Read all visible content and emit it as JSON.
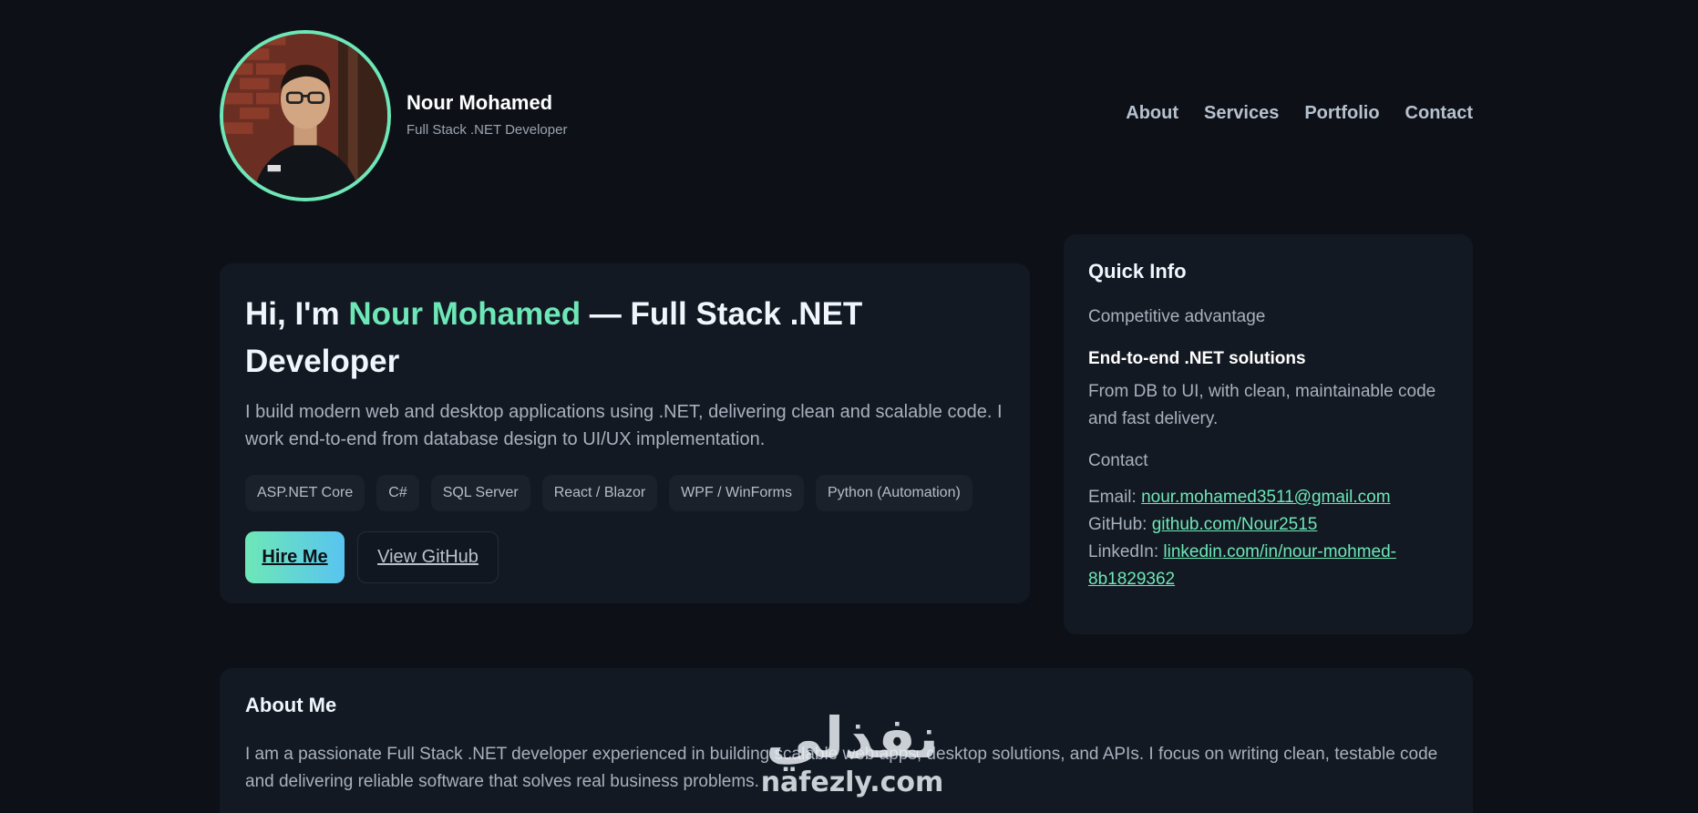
{
  "header": {
    "name": "Nour Mohamed",
    "role": "Full Stack .NET Developer",
    "nav": [
      "About",
      "Services",
      "Portfolio",
      "Contact"
    ]
  },
  "hero": {
    "title_prefix": "Hi, I'm ",
    "title_accent": "Nour Mohamed",
    "title_suffix": " — Full Stack .NET Developer",
    "description": "I build modern web and desktop applications using .NET, delivering clean and scalable code. I work end-to-end from database design to UI/UX implementation.",
    "tags": [
      "ASP.NET Core",
      "C#",
      "SQL Server",
      "React / Blazor",
      "WPF / WinForms",
      "Python (Automation)"
    ],
    "primary_button": "Hire Me",
    "secondary_button": "View GitHub"
  },
  "quick_info": {
    "title": "Quick Info",
    "advantage_label": "Competitive advantage",
    "advantage_title": "End-to-end .NET solutions",
    "advantage_text": "From DB to UI, with clean, maintainable code and fast delivery.",
    "contact_label": "Contact",
    "email_label": "Email: ",
    "email": "nour.mohamed3511@gmail.com",
    "github_label": "GitHub: ",
    "github": "github.com/Nour2515",
    "linkedin_label": "LinkedIn: ",
    "linkedin": "linkedin.com/in/nour-mohmed-8b1829362"
  },
  "about": {
    "title": "About Me",
    "text": "I am a passionate Full Stack .NET developer experienced in building scalable web apps, desktop solutions, and APIs. I focus on writing clean, testable code and delivering reliable software that solves real business problems."
  },
  "watermark": {
    "arabic": "نفذلي",
    "latin": "nafezly.com"
  },
  "colors": {
    "background": "#0d1117",
    "card": "#131922",
    "accent": "#6ee7b7",
    "accent_gradient_end": "#58c4f0"
  }
}
